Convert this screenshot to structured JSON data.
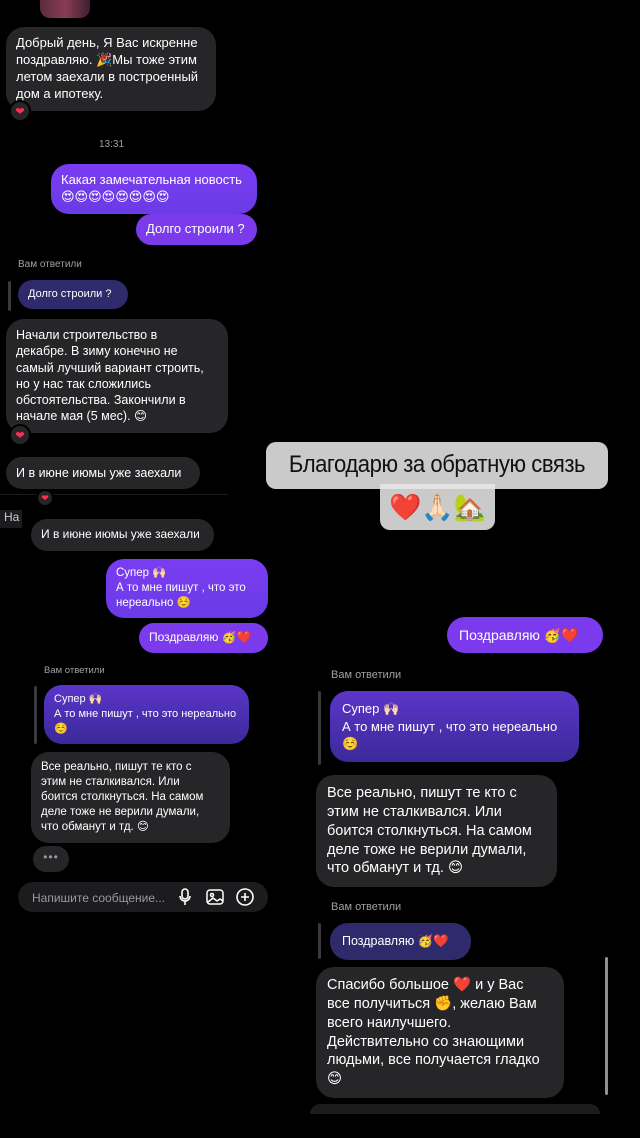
{
  "left": {
    "msg_greeting": "Добрый день, Я Вас искренне\nпоздравляю. 🎉Мы тоже этим\nлетом заехали в построенный\nдом а ипотеку.",
    "time": "13:31",
    "msg_great_news": "Какая замечательная новость\n😍😍😍😍😍😍😍😍",
    "msg_how_long": "Долго строили ?",
    "replied_label_1": "Вам ответили",
    "quote_how_long": "Долго строили ?",
    "msg_started": "Начали строительство в\nдекабре. В зиму конечно не\nсамый лучший вариант строить,\nно у нас так сложились\nобстоятельства. Закончили в\nначале мая (5 мес). 😊",
    "msg_june": "И в июне июмы уже заехали",
    "side_fragment": "На",
    "msg_june_2": "И в июне июмы уже заехали",
    "msg_super": "Супер 🙌🏻\nА то мне пишут , что это\nнереально ☺️",
    "msg_congrats": "Поздравляю 🥳❤️",
    "replied_label_2": "Вам ответили",
    "quote_super": "Супер 🙌🏻\nА то мне пишут , что это нереально\n☺️",
    "msg_real": "Все реально, пишут те кто с\nэтим не сталкивался. Или\nбоится столкнуться. На самом\nделе тоже не верили думали,\nчто обманут и тд. 😊",
    "typing": "•••",
    "composer_placeholder": "Напишите сообщение..."
  },
  "right": {
    "card_title": "Благодарю за обратную связь",
    "card_emojis": "❤️🙏🏻🏡",
    "msg_congrats": "Поздравляю 🥳❤️",
    "replied_label_1": "Вам ответили",
    "quote_super": "Супер 🙌🏻\nА то мне пишут , что это нереально\n☺️",
    "msg_real": "Все реально, пишут те кто с\nэтим не сталкивался. Или\nбоится столкнуться. На самом\nделе тоже не верили думали,\nчто обманут и тд. 😊",
    "replied_label_2": "Вам ответили",
    "quote_congrats": "Поздравляю 🥳❤️",
    "msg_thanks": "Спасибо большое ❤️ и у Вас\nвсе получиться ✊, желаю Вам\nвсего наилучшего.\nДействительно со знающими\nлюдьми, все получается гладко\n😊"
  },
  "reactions": {
    "heart": "❤"
  },
  "icons": [
    "mic-icon",
    "gallery-icon",
    "add-icon"
  ]
}
